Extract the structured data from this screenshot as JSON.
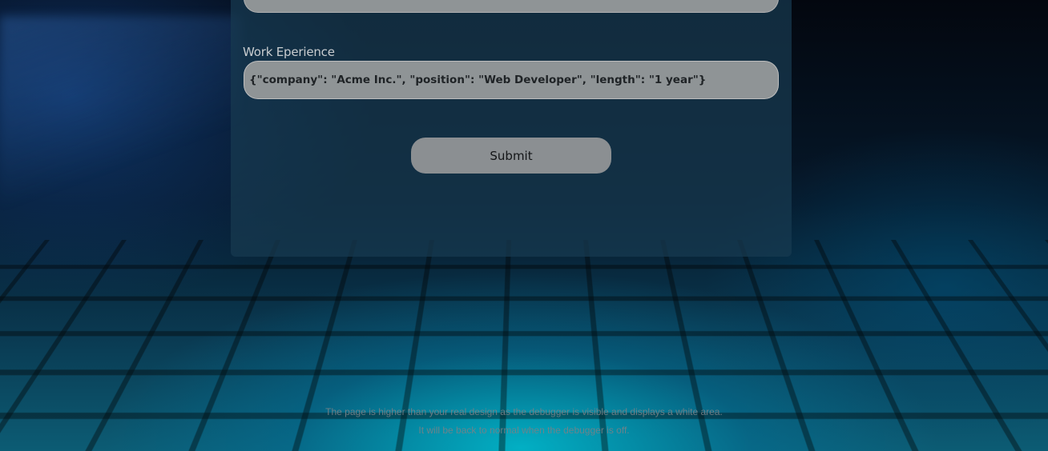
{
  "form": {
    "work_experience_label": "Work Eperience",
    "work_experience_value": "{\"company\": \"Acme Inc.\", \"position\": \"Web Developer\", \"length\": \"1 year\"}",
    "submit_label": "Submit"
  },
  "debugger_notice": {
    "line1": "The page is higher than your real design as the debugger is visible and displays a white area.",
    "line2": "It will be back to normal when the debugger is off."
  }
}
